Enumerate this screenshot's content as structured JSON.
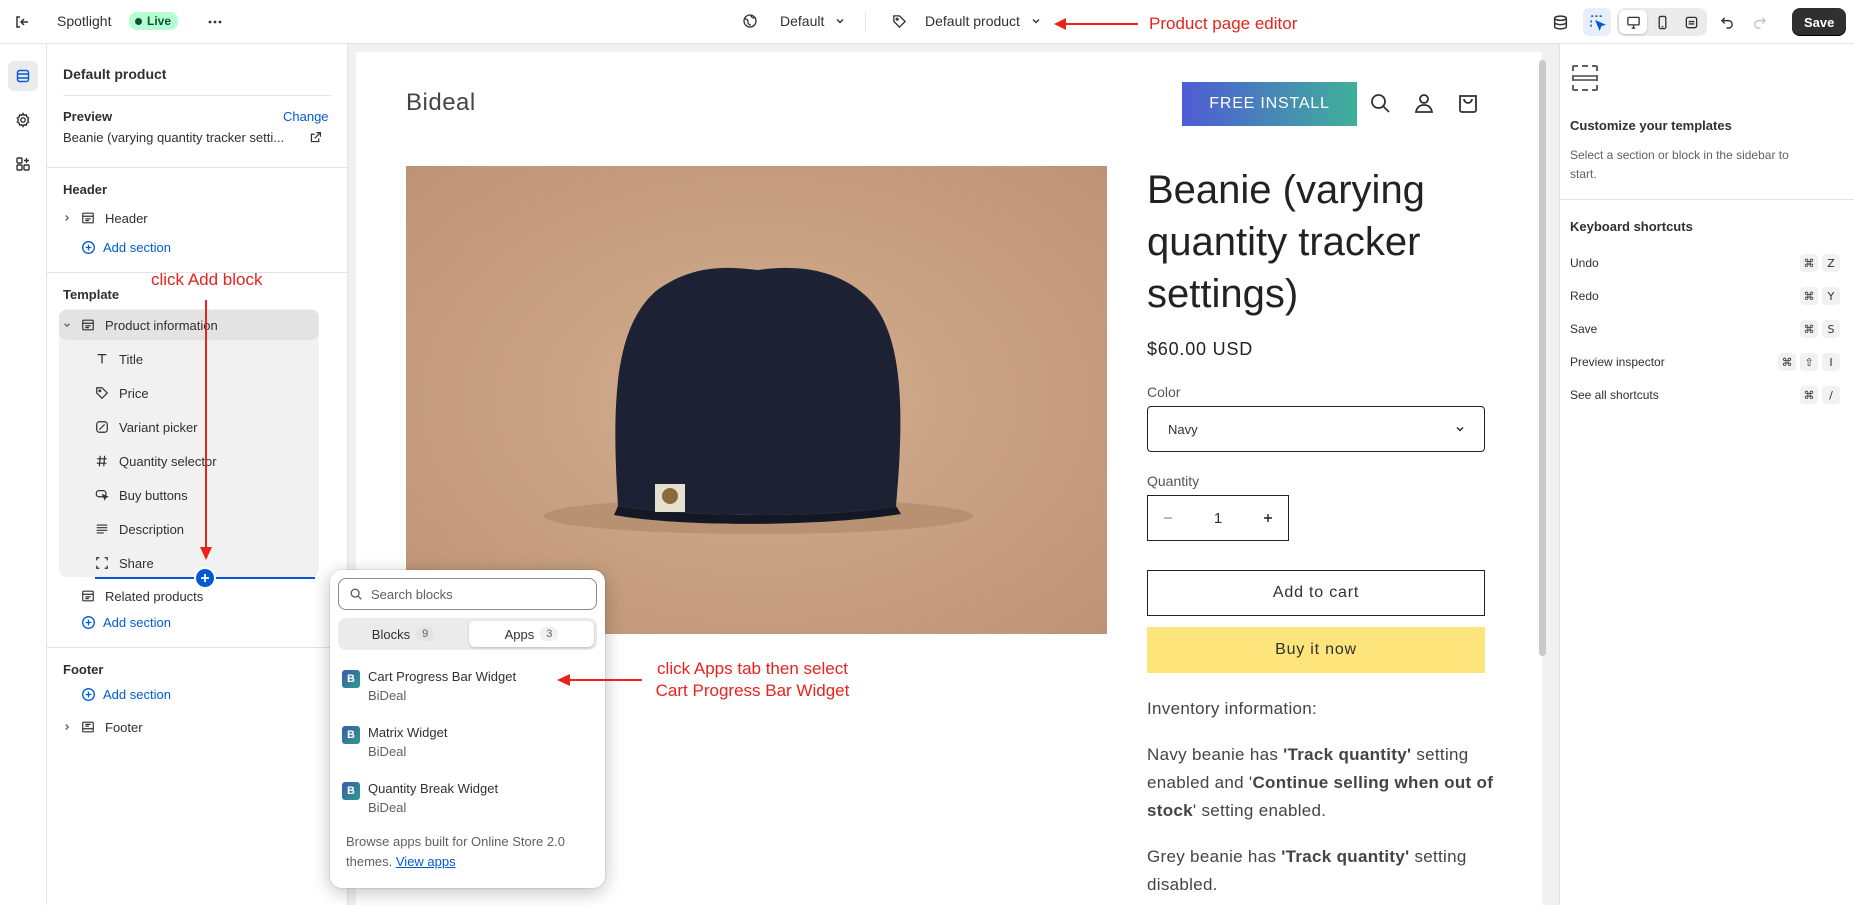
{
  "topbar": {
    "app_name": "Spotlight",
    "live_label": "Live",
    "theme_selector": "Default",
    "template_selector": "Default product",
    "save_label": "Save"
  },
  "sidebar": {
    "title": "Default product",
    "preview_label": "Preview",
    "change_link": "Change",
    "preview_product": "Beanie (varying quantity tracker setti...",
    "header_group": {
      "heading": "Header",
      "items": [
        "Header"
      ],
      "add_section": "Add section"
    },
    "template_group": {
      "heading": "Template",
      "section": "Product information",
      "blocks": [
        "Title",
        "Price",
        "Variant picker",
        "Quantity selector",
        "Buy buttons",
        "Description",
        "Share"
      ],
      "related": "Related products",
      "add_section": "Add section"
    },
    "footer_group": {
      "heading": "Footer",
      "add_section": "Add section",
      "items": [
        "Footer"
      ]
    }
  },
  "popover": {
    "search_placeholder": "Search blocks",
    "tabs": [
      {
        "label": "Blocks",
        "count": "9"
      },
      {
        "label": "Apps",
        "count": "3"
      }
    ],
    "apps": [
      {
        "name": "Cart Progress Bar Widget",
        "vendor": "BiDeal"
      },
      {
        "name": "Matrix Widget",
        "vendor": "BiDeal"
      },
      {
        "name": "Quantity Break Widget",
        "vendor": "BiDeal"
      }
    ],
    "footer_text": "Browse apps built for Online Store 2.0 themes.",
    "footer_link": "View apps"
  },
  "store": {
    "logo": "Bideal",
    "cta": "FREE INSTALL",
    "product_title": "Beanie (varying quantity tracker settings)",
    "price": "$60.00 USD",
    "color_label": "Color",
    "color_value": "Navy",
    "quantity_label": "Quantity",
    "quantity_value": "1",
    "add_to_cart": "Add to cart",
    "buy_now": "Buy it now",
    "inventory_heading": "Inventory information:",
    "para1": {
      "a": "Navy beanie has ",
      "b": "'Track quantity'",
      "c": " setting enabled and '",
      "d": "Continue selling when out of stock",
      "e": "' setting enabled."
    },
    "para2": {
      "a": "Grey beanie has ",
      "b": "'Track quantity'",
      "c": " setting disabled."
    }
  },
  "inspector": {
    "title": "Customize your templates",
    "subtitle": "Select a section or block in the sidebar to start.",
    "shortcuts_heading": "Keyboard shortcuts",
    "shortcuts": [
      {
        "label": "Undo",
        "keys": [
          "⌘",
          "Z"
        ]
      },
      {
        "label": "Redo",
        "keys": [
          "⌘",
          "Y"
        ]
      },
      {
        "label": "Save",
        "keys": [
          "⌘",
          "S"
        ]
      },
      {
        "label": "Preview inspector",
        "keys": [
          "⌘",
          "⇧",
          "I"
        ]
      },
      {
        "label": "See all shortcuts",
        "keys": [
          "⌘",
          "/"
        ]
      }
    ]
  },
  "annotations": {
    "editor": "Product page editor",
    "add_block": "click Add block",
    "apps_line1": "click Apps tab then select",
    "apps_line2": "Cart Progress Bar Widget"
  },
  "colors": {
    "accent": "#005bd3",
    "annotation": "#e8231b",
    "cta_gradient_start": "#4f5bd5",
    "cta_gradient_end": "#3fb09a",
    "buy_now": "#fde57b",
    "beanie": "#1c2233",
    "backdrop": "#caa384"
  }
}
